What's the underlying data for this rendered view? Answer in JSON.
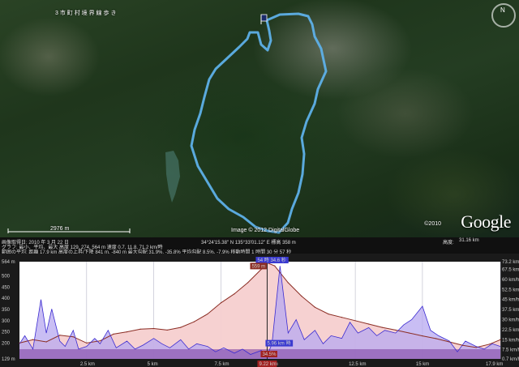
{
  "map": {
    "title": "3 市 町 村 境 界 線 歩 き",
    "scale_label": "2976 m",
    "imagery_credit": "Image © 2012 DigitalGlobe",
    "copyright_year": "©2010",
    "logo": "Google",
    "track_color": "#5eb0e8"
  },
  "infobar": {
    "row1": {
      "date": "画像取得日: 2010 年 3 月 22 日",
      "coords": "34°24'15.38\" N   135°33'01.12\" E   標高   358 m",
      "alt_label": "高度:",
      "alt_value": "31.16 km"
    },
    "row2": "グラフ: 最小、平均、最大  高度 129, 274, 564 m   速度 0.7, 11.8, 71.2 km/時",
    "row3": "範囲の平均: 距離 17.9 km  高度の上昇/下降 841 m, -840 m  最大勾配 31.9%, -35.8%  平均勾配 8.5%, -7.9%  移動時間 1 時間 30 分 57 秒"
  },
  "profile": {
    "marker": {
      "distance": "9.22 km",
      "elevation": "559 m",
      "speed_top": "54 時 34.6 秒",
      "speed_low": "5.96 km 時",
      "grade": "34.5%"
    },
    "colors": {
      "elevation_fill": "#f6cfcf",
      "elevation_line": "#8b2d24",
      "speed_fill": "#b7a8f0",
      "speed_line": "#3a2ad0",
      "base_fill": "#7a3aa0"
    }
  },
  "chart_data": {
    "type": "area",
    "title": "",
    "xlabel": "",
    "x_ticks": [
      "2.5 km",
      "5 km",
      "7.5 km",
      "9.22 km",
      "12.5 km",
      "15 km",
      "17.9 km"
    ],
    "xlim": [
      0,
      17.9
    ],
    "y_left_ticks": [
      "564 m",
      "500",
      "450",
      "400",
      "350",
      "300",
      "250",
      "200",
      "129 m"
    ],
    "ylim_left": [
      129,
      564
    ],
    "y_right_ticks": [
      "73.2 km/h",
      "67.5 km/h",
      "60 km/h",
      "52.5 km/h",
      "45 km/h",
      "37.5 km/h",
      "30 km/h",
      "22.5 km/h",
      "15 km/h",
      "7.5 km/h",
      "0.7 km/h"
    ],
    "ylim_right": [
      0.7,
      73.2
    ],
    "series": [
      {
        "name": "高度",
        "axis": "left",
        "x": [
          0,
          0.5,
          1,
          1.5,
          2,
          2.5,
          3,
          3.5,
          4,
          4.5,
          5,
          5.5,
          6,
          6.5,
          7,
          7.5,
          8,
          8.5,
          9,
          9.22,
          9.5,
          10,
          10.5,
          11,
          11.5,
          12,
          12.5,
          13,
          13.5,
          14,
          14.5,
          15,
          15.5,
          16,
          16.5,
          17,
          17.5,
          17.9
        ],
        "y": [
          200,
          215,
          205,
          235,
          228,
          200,
          210,
          240,
          250,
          262,
          265,
          258,
          270,
          295,
          330,
          380,
          420,
          470,
          530,
          559,
          545,
          470,
          410,
          360,
          330,
          315,
          300,
          285,
          270,
          258,
          245,
          232,
          220,
          205,
          190,
          180,
          195,
          215
        ]
      },
      {
        "name": "速度",
        "axis": "right",
        "x": [
          0,
          0.2,
          0.5,
          0.8,
          1,
          1.2,
          1.5,
          1.7,
          2,
          2.2,
          2.5,
          2.8,
          3,
          3.3,
          3.6,
          4,
          4.3,
          4.6,
          5,
          5.3,
          5.6,
          6,
          6.3,
          6.6,
          7,
          7.3,
          7.6,
          8,
          8.3,
          8.6,
          9,
          9.22,
          9.4,
          9.7,
          10,
          10.3,
          10.6,
          11,
          11.3,
          11.6,
          12,
          12.3,
          12.6,
          13,
          13.3,
          13.6,
          14,
          14.3,
          14.6,
          15,
          15.3,
          15.6,
          16,
          16.3,
          16.6,
          17,
          17.3,
          17.6,
          17.9
        ],
        "y": [
          12,
          18,
          8,
          45,
          20,
          38,
          14,
          10,
          22,
          8,
          10,
          16,
          12,
          22,
          9,
          14,
          8,
          11,
          16,
          12,
          9,
          15,
          8,
          12,
          10,
          6,
          9,
          5,
          8,
          4,
          7,
          3,
          12,
          70,
          20,
          30,
          15,
          22,
          12,
          18,
          16,
          28,
          20,
          24,
          18,
          22,
          20,
          26,
          30,
          40,
          22,
          18,
          14,
          6,
          14,
          10,
          8,
          12,
          10
        ]
      }
    ],
    "marker_x": 9.22
  }
}
